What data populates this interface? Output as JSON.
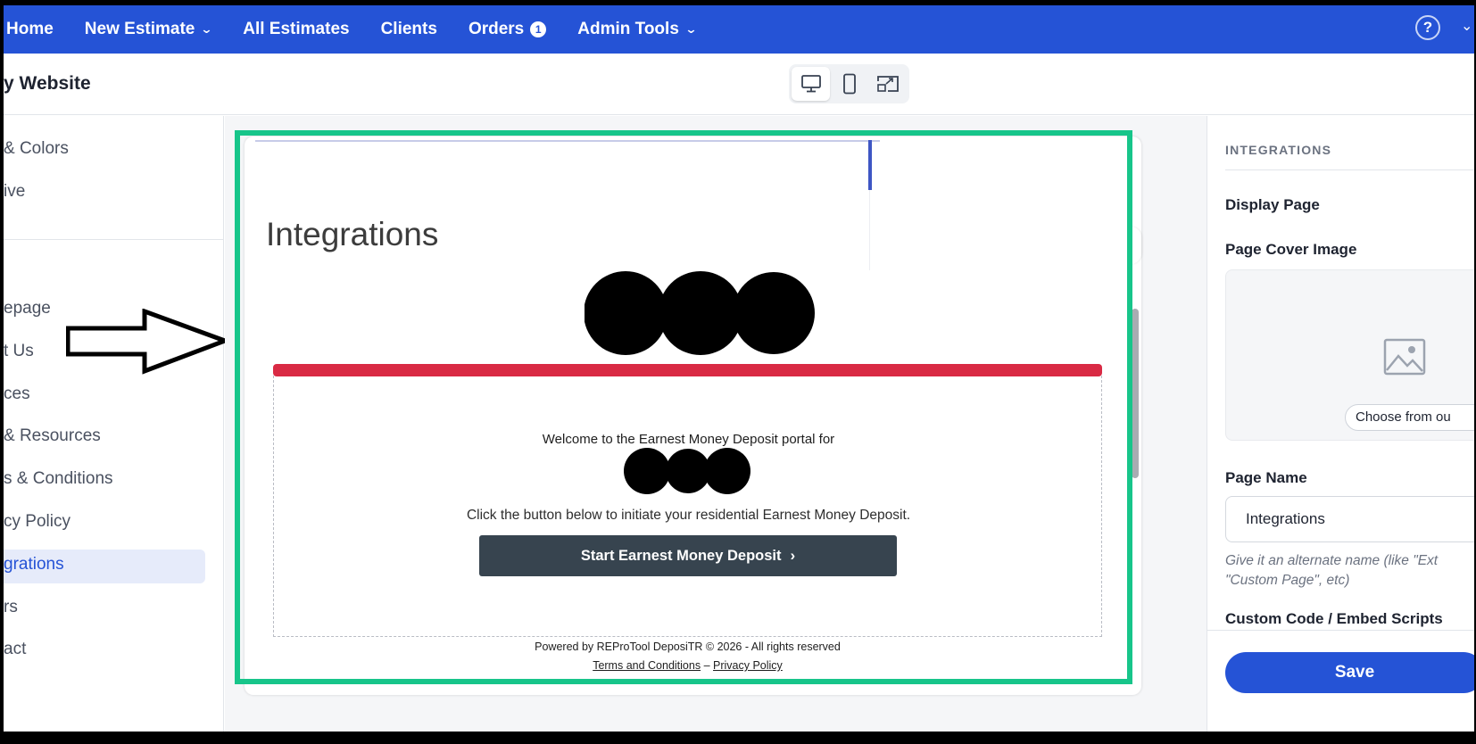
{
  "nav": {
    "items": [
      {
        "label": "Home",
        "has_chevron": false
      },
      {
        "label": "New Estimate",
        "has_chevron": true
      },
      {
        "label": "All Estimates",
        "has_chevron": false
      },
      {
        "label": "Clients",
        "has_chevron": false
      },
      {
        "label": "Orders",
        "badge": "1"
      },
      {
        "label": "Admin Tools",
        "has_chevron": true
      }
    ],
    "help_label": "?",
    "color": "#2553d6"
  },
  "subheader": {
    "title": "y Website",
    "device_modes": [
      "desktop-icon",
      "mobile-icon",
      "fullscreen-icon"
    ],
    "active_mode": "desktop"
  },
  "sidebar": {
    "items": [
      {
        "label": "& Colors"
      },
      {
        "label": "ive"
      },
      {
        "label": "epage"
      },
      {
        "label": "t Us"
      },
      {
        "label": "ces"
      },
      {
        "label": "& Resources"
      },
      {
        "label": "s & Conditions"
      },
      {
        "label": "cy Policy"
      },
      {
        "label": "grations",
        "active": true
      },
      {
        "label": "rs"
      },
      {
        "label": "act"
      }
    ]
  },
  "preview": {
    "heading": "Integrations",
    "welcome_text": "Welcome to the Earnest Money Deposit portal for",
    "instruction_text": "Click the button below to initiate your residential Earnest Money Deposit.",
    "start_button": "Start Earnest Money Deposit",
    "footer_text": "Powered by REProTool DeposiTR © 2026 - All rights reserved",
    "footer_links": [
      "Terms and Conditions",
      "Privacy Policy"
    ],
    "footer_separator": "–",
    "accent_color": "#d92a44",
    "button_color": "#37444f"
  },
  "highlight": {
    "color": "#17c58a"
  },
  "right_panel": {
    "section_title": "INTEGRATIONS",
    "display_page_label": "Display Page",
    "cover_image_label": "Page Cover Image",
    "choose_button": "Choose from ou",
    "page_name_label": "Page Name",
    "page_name_value": "Integrations",
    "page_name_help": "Give it an alternate name (like \"Ext \"Custom Page\", etc)",
    "custom_code_label": "Custom Code / Embed Scripts",
    "save_button": "Save"
  }
}
